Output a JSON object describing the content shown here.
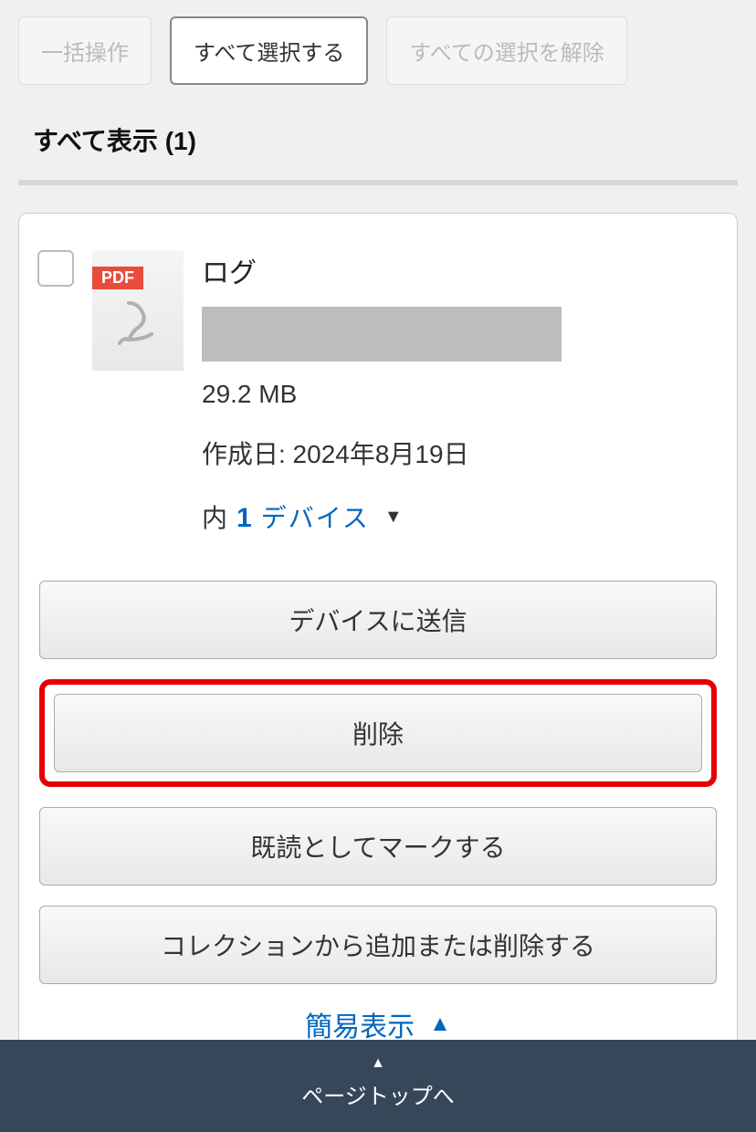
{
  "tabs": {
    "bulk": "一括操作",
    "selectAll": "すべて選択する",
    "deselectAll": "すべての選択を解除"
  },
  "listHeader": "すべて表示 (1)",
  "item": {
    "pdfBadge": "PDF",
    "title": "ログ",
    "size": "29.2 MB",
    "dateLabel": "作成日: 2024年8月19日",
    "devicePrefix": "内",
    "deviceCount": "1",
    "deviceWord": "デバイス"
  },
  "actions": {
    "send": "デバイスに送信",
    "delete": "削除",
    "markRead": "既読としてマークする",
    "collection": "コレクションから追加または削除する"
  },
  "simpleView": "簡易表示",
  "footer": "ページトップへ"
}
